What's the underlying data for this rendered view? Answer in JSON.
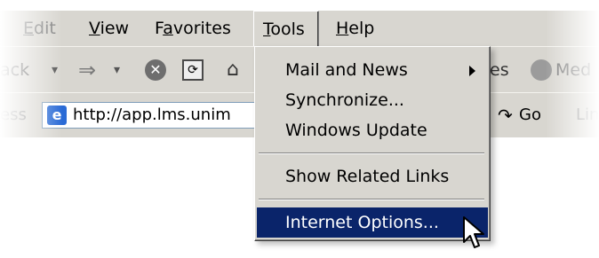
{
  "menubar": {
    "items": [
      {
        "label": "Edit",
        "underline": "E",
        "rest": "dit"
      },
      {
        "label": "View",
        "underline": "V",
        "rest": "iew"
      },
      {
        "label": "Favorites",
        "pre": "F",
        "underline": "a",
        "rest": "vorites"
      },
      {
        "label": "Tools",
        "underline": "T",
        "rest": "ools"
      },
      {
        "label": "Help",
        "underline": "H",
        "rest": "elp"
      }
    ]
  },
  "toolbar": {
    "back_label": "ack",
    "forward_arrow": "⇒",
    "dropdown_caret": "▾",
    "stop_glyph": "✕",
    "refresh_glyph": "⟳",
    "home_glyph": "⌂",
    "favorites_tail": "es",
    "media_label": "Med"
  },
  "addressbar": {
    "label_tail": "ess",
    "url": "http://app.lms.unim",
    "go_label": "Go",
    "go_glyph": "↷",
    "links_label": "Lin"
  },
  "tools_menu": {
    "items": [
      {
        "label": "Mail and News",
        "has_submenu": true,
        "selected": false
      },
      {
        "label": "Synchronize...",
        "has_submenu": false,
        "selected": false
      },
      {
        "label": "Windows Update",
        "has_submenu": false,
        "selected": false
      },
      {
        "label": "Show Related Links",
        "has_submenu": false,
        "selected": false
      },
      {
        "label": "Internet Options...",
        "has_submenu": false,
        "selected": true
      }
    ]
  },
  "colors": {
    "chrome": "#d8d6d0",
    "selection": "#0a246a"
  }
}
